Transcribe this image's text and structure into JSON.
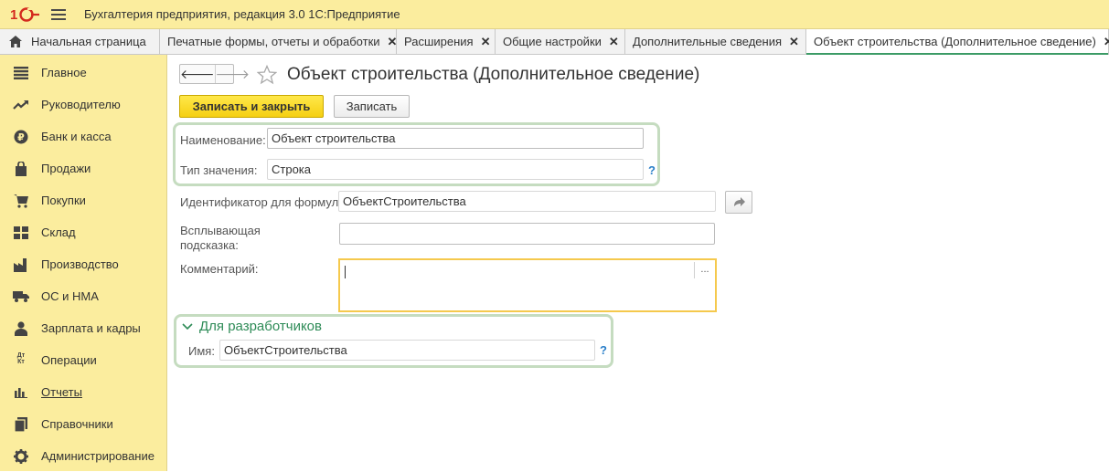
{
  "app": {
    "title": "Бухгалтерия предприятия, редакция 3.0 1С:Предприятие",
    "logo_text": "1С"
  },
  "tabs": [
    {
      "label": "Начальная страница",
      "closable": false,
      "active": false
    },
    {
      "label": "Печатные формы, отчеты и обработки",
      "closable": true,
      "active": false
    },
    {
      "label": "Расширения",
      "closable": true,
      "active": false
    },
    {
      "label": "Общие настройки",
      "closable": true,
      "active": false
    },
    {
      "label": "Дополнительные сведения",
      "closable": true,
      "active": false
    },
    {
      "label": "Объект строительства (Дополнительное сведение)",
      "closable": true,
      "active": true
    }
  ],
  "tab_close_glyph": "✕",
  "sidebar": {
    "items": [
      {
        "label": "Главное",
        "icon": "list-icon"
      },
      {
        "label": "Руководителю",
        "icon": "trend-icon"
      },
      {
        "label": "Банк и касса",
        "icon": "ruble-icon"
      },
      {
        "label": "Продажи",
        "icon": "bag-icon"
      },
      {
        "label": "Покупки",
        "icon": "cart-icon"
      },
      {
        "label": "Склад",
        "icon": "warehouse-icon"
      },
      {
        "label": "Производство",
        "icon": "factory-icon"
      },
      {
        "label": "ОС и НМА",
        "icon": "truck-icon"
      },
      {
        "label": "Зарплата и кадры",
        "icon": "person-icon"
      },
      {
        "label": "Операции",
        "icon": "debit-credit-icon"
      },
      {
        "label": "Отчеты",
        "icon": "bar-chart-icon",
        "underline": true
      },
      {
        "label": "Справочники",
        "icon": "books-icon"
      },
      {
        "label": "Администрирование",
        "icon": "gear-icon"
      }
    ],
    "dt_kt_glyph": "Дт Кт"
  },
  "form": {
    "title": "Объект строительства (Дополнительное сведение)",
    "back_glyph": "🡐",
    "forward_glyph": "🡒",
    "save_close_label": "Записать и закрыть",
    "save_label": "Записать",
    "name_label": "Наименование:",
    "name_value": "Объект строительства",
    "value_type_label": "Тип значения:",
    "value_type_value": "Строка",
    "help_glyph": "?",
    "formula_id_label": "Идентификатор для формул:",
    "formula_id_value": "ОбъектСтроительства",
    "tooltip_label_line1": "Всплывающая",
    "tooltip_label_line2": "подсказка:",
    "tooltip_value": "",
    "comment_label": "Комментарий:",
    "comment_value": "",
    "comment_more_glyph": "...",
    "dev_group_title": "Для разработчиков",
    "dev_name_label": "Имя:",
    "dev_name_value": "ОбъектСтроительства"
  },
  "colors": {
    "panel_yellow": "#fbed9e",
    "active_tab_underline": "#3c9b66",
    "group_outline": "#c5dcc0",
    "primary_button": "#f5cf12",
    "help_blue": "#2a7fc9",
    "dev_group_green": "#2e8b57",
    "comment_focus": "#f5c94d"
  }
}
